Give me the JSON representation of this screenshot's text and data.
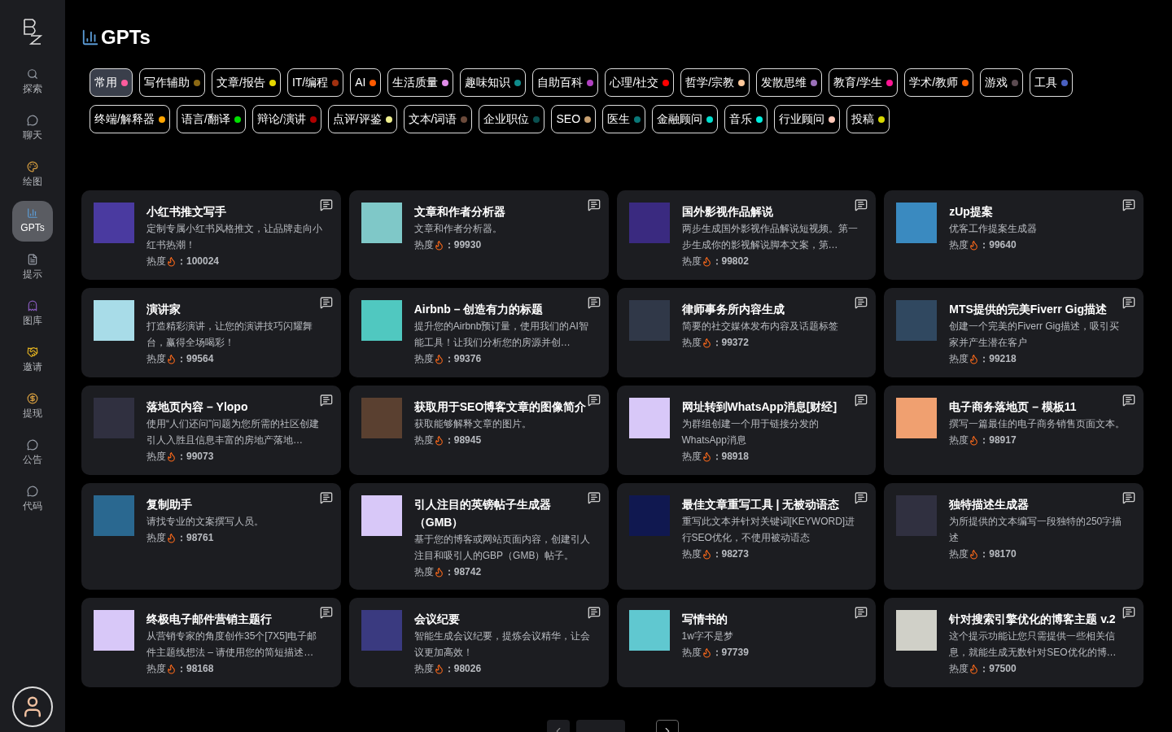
{
  "sidebar": {
    "items": [
      {
        "kind": "search",
        "label": "探索",
        "selected": false
      },
      {
        "kind": "chat",
        "label": "聊天",
        "selected": false
      },
      {
        "kind": "palette",
        "label": "绘图",
        "selected": false
      },
      {
        "kind": "chart",
        "label": "GPTs",
        "selected": true
      },
      {
        "kind": "file",
        "label": "提示",
        "selected": false
      },
      {
        "kind": "alien",
        "label": "图库",
        "selected": false
      },
      {
        "kind": "handshake",
        "label": "邀请",
        "selected": false
      },
      {
        "kind": "money",
        "label": "提现",
        "selected": false
      },
      {
        "kind": "chat",
        "label": "公告",
        "selected": false
      },
      {
        "kind": "chat",
        "label": "代码",
        "selected": false
      }
    ]
  },
  "page_title": "GPTs",
  "categories": [
    {
      "label": "常用",
      "color": "#ff5c9d",
      "selected": true
    },
    {
      "label": "写作辅助",
      "color": "#8b6914",
      "selected": false
    },
    {
      "label": "文章/报告",
      "color": "#e6d800",
      "selected": false
    },
    {
      "label": "IT/编程",
      "color": "#a0300f",
      "selected": false
    },
    {
      "label": "AI",
      "color": "#ff5a00",
      "selected": false
    },
    {
      "label": "生活质量",
      "color": "#e08ce8",
      "selected": false
    },
    {
      "label": "趣味知识",
      "color": "#0f8c8c",
      "selected": false
    },
    {
      "label": "自助百科",
      "color": "#b040c0",
      "selected": false
    },
    {
      "label": "心理/社交",
      "color": "#ff0000",
      "selected": false
    },
    {
      "label": "哲学/宗教",
      "color": "#ffc89a",
      "selected": false
    },
    {
      "label": "发散思维",
      "color": "#9a70b8",
      "selected": false
    },
    {
      "label": "教育/学生",
      "color": "#ff1493",
      "selected": false
    },
    {
      "label": "学术/教师",
      "color": "#ff6000",
      "selected": false
    },
    {
      "label": "游戏",
      "color": "#5a4a50",
      "selected": false
    },
    {
      "label": "工具",
      "color": "#4a60c0",
      "selected": false
    },
    {
      "label": "终端/解释器",
      "color": "#ffa500",
      "selected": false
    },
    {
      "label": "语言/翻译",
      "color": "#00e000",
      "selected": false
    },
    {
      "label": "辩论/演讲",
      "color": "#b00000",
      "selected": false
    },
    {
      "label": "点评/评鉴",
      "color": "#f0f090",
      "selected": false
    },
    {
      "label": "文本/词语",
      "color": "#6b4a3a",
      "selected": false
    },
    {
      "label": "企业职位",
      "color": "#0a5050",
      "selected": false
    },
    {
      "label": "SEO",
      "color": "#c8a070",
      "selected": false
    },
    {
      "label": "医生",
      "color": "#0a7878",
      "selected": false
    },
    {
      "label": "金融顾问",
      "color": "#00e0d0",
      "selected": false
    },
    {
      "label": "音乐",
      "color": "#00f0e0",
      "selected": false
    },
    {
      "label": "行业顾问",
      "color": "#ffc8b8",
      "selected": false
    },
    {
      "label": "投稿",
      "color": "#d8d800",
      "selected": false
    }
  ],
  "cards": [
    {
      "title": "小红书推文写手",
      "description": "定制专属小红书风格推文，让品牌走向小红书热潮！",
      "heat_label": "热度",
      "heat": "：100024"
    },
    {
      "title": "文章和作者分析器",
      "description": "文章和作者分析器。",
      "heat_label": "热度",
      "heat": "：99930"
    },
    {
      "title": "国外影视作品解说",
      "description": "两步生成国外影视作品解说短视频。第一步生成你的影视解说脚本文案，第…",
      "heat_label": "热度",
      "heat": "：99802"
    },
    {
      "title": "zUp提案",
      "description": "优客工作提案生成器",
      "heat_label": "热度",
      "heat": "：99640"
    },
    {
      "title": "演讲家",
      "description": "打造精彩演讲，让您的演讲技巧闪耀舞台，赢得全场喝彩！",
      "heat_label": "热度",
      "heat": "：99564"
    },
    {
      "title": "Airbnb – 创造有力的标题",
      "description": "提升您的Airbnb预订量，使用我们的AI智能工具！让我们分析您的房源并创…",
      "heat_label": "热度",
      "heat": "：99376"
    },
    {
      "title": "律师事务所内容生成",
      "description": "简要的社交媒体发布内容及话题标签",
      "heat_label": "热度",
      "heat": "：99372"
    },
    {
      "title": "MTS提供的完美Fiverr Gig描述",
      "description": "创建一个完美的Fiverr Gig描述，吸引买家并产生潜在客户",
      "heat_label": "热度",
      "heat": "：99218"
    },
    {
      "title": "落地页内容 – Ylopo",
      "description": "使用“人们还问”问题为您所需的社区创建引人入胜且信息丰富的房地产落地…",
      "heat_label": "热度",
      "heat": "：99073"
    },
    {
      "title": "获取用于SEO博客文章的图像简介",
      "description": "获取能够解释文章的图片。",
      "heat_label": "热度",
      "heat": "：98945"
    },
    {
      "title": "网址转到WhatsApp消息[财经]",
      "description": "为群组创建一个用于链接分发的WhatsApp消息",
      "heat_label": "热度",
      "heat": "：98918"
    },
    {
      "title": "电子商务落地页 – 模板11",
      "description": "撰写一篇最佳的电子商务销售页面文本。",
      "heat_label": "热度",
      "heat": "：98917"
    },
    {
      "title": "复制助手",
      "description": "请找专业的文案撰写人员。",
      "heat_label": "热度",
      "heat": "：98761"
    },
    {
      "title": "引人注目的英镑帖子生成器（GMB）",
      "description": "基于您的博客或网站页面内容，创建引人注目和吸引人的GBP（GMB）帖子。",
      "heat_label": "热度",
      "heat": "：98742"
    },
    {
      "title": "最佳文章重写工具 | 无被动语态",
      "description": "重写此文本并针对关键词[KEYWORD]进行SEO优化，不使用被动语态",
      "heat_label": "热度",
      "heat": "：98273"
    },
    {
      "title": "独特描述生成器",
      "description": "为所提供的文本编写一段独特的250字描述",
      "heat_label": "热度",
      "heat": "：98170"
    },
    {
      "title": "终极电子邮件营销主题行",
      "description": "从营销专家的角度创作35个[7X5]电子邮件主题线想法 – 请使用您的简短描述…",
      "heat_label": "热度",
      "heat": "：98168"
    },
    {
      "title": "会议纪要",
      "description": "智能生成会议纪要，提炼会议精华，让会议更加高效！",
      "heat_label": "热度",
      "heat": "：98026"
    },
    {
      "title": "写情书的",
      "description": "1w字不是梦",
      "heat_label": "热度",
      "heat": "：97739"
    },
    {
      "title": "针对搜索引擎优化的博客主题 v.2",
      "description": "这个提示功能让您只需提供一些相关信息，就能生成无数针对SEO优化的博…",
      "heat_label": "热度",
      "heat": "：97500"
    }
  ]
}
